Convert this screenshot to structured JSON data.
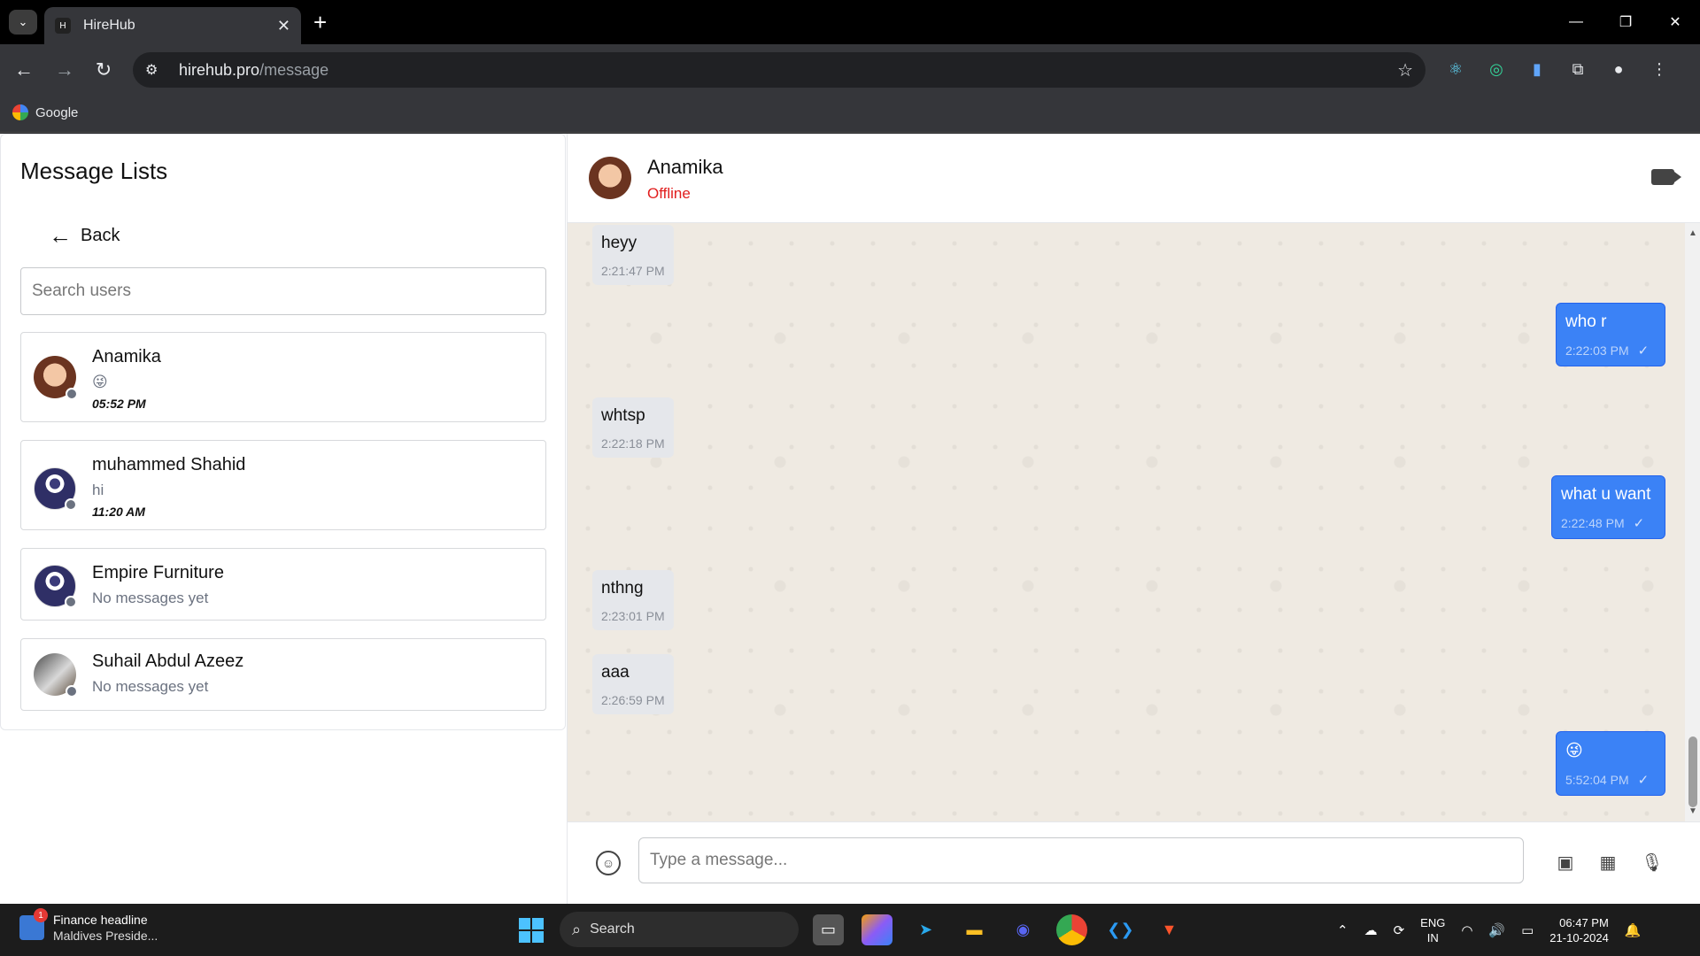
{
  "browser": {
    "tab_title": "HireHub",
    "new_tab_label": "+",
    "url_host": "hirehub.pro",
    "url_path": "/message",
    "bookmark_label": "Google"
  },
  "sidebar": {
    "title": "Message Lists",
    "back_label": "Back",
    "search_placeholder": "Search users",
    "users": [
      {
        "name": "Anamika",
        "last_message": "😜",
        "time": "05:52 PM",
        "avatar": "girl-avatar"
      },
      {
        "name": "muhammed Shahid",
        "last_message": "hi",
        "time": "11:20 AM",
        "avatar": "default-avatar"
      },
      {
        "name": "Empire Furniture",
        "last_message": "No messages yet",
        "time": "",
        "avatar": "default-avatar"
      },
      {
        "name": "Suhail Abdul Azeez",
        "last_message": "No messages yet",
        "time": "",
        "avatar": "photo-avatar"
      }
    ]
  },
  "chat": {
    "contact_name": "Anamika",
    "contact_status": "Offline",
    "status_color": "#e11d1d",
    "messages": [
      {
        "direction": "in",
        "text": "heyy",
        "time": "2:21:47 PM"
      },
      {
        "direction": "out",
        "text": "who r",
        "time": "2:22:03 PM"
      },
      {
        "direction": "in",
        "text": "whtsp",
        "time": "2:22:18 PM"
      },
      {
        "direction": "out",
        "text": "what u want",
        "time": "2:22:48 PM"
      },
      {
        "direction": "in",
        "text": "nthng",
        "time": "2:23:01 PM"
      },
      {
        "direction": "in",
        "text": "aaa",
        "time": "2:26:59 PM"
      },
      {
        "direction": "out",
        "text": "😜",
        "time": "5:52:04 PM"
      }
    ],
    "input_placeholder": "Type a message..."
  },
  "taskbar": {
    "news_badge": "1",
    "news_title": "Finance headline",
    "news_subtitle": "Maldives Preside...",
    "search_label": "Search",
    "lang_line1": "ENG",
    "lang_line2": "IN",
    "time": "06:47 PM",
    "date": "21-10-2024"
  },
  "colors": {
    "accent": "#3b82f6",
    "chat_bg": "#efeae2"
  }
}
